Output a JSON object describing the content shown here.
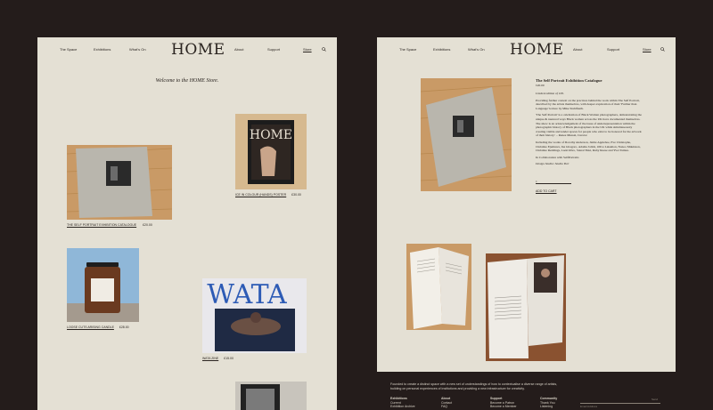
{
  "nav_left": {
    "items": [
      "The Space",
      "Exhibitions",
      "What's On"
    ],
    "logo": "HOME",
    "items_right": [
      "About",
      "Support",
      "Store"
    ],
    "search_icon": "search-icon"
  },
  "nav_right": {
    "items": [
      "The Space",
      "Exhibitions",
      "What's On"
    ],
    "logo": "HOME",
    "items_right": [
      "About",
      "Support",
      "Store"
    ],
    "search_icon": "search-icon"
  },
  "store": {
    "welcome": "Welcome to the HOME Store.",
    "products": [
      {
        "name": "The Self Portrait Exhibition Catalogue",
        "price": "£20.00"
      },
      {
        "name": "Ice in Colour (Hands) Poster",
        "price": "£30.00"
      },
      {
        "name": "Loose Cuts Arising Candle",
        "price": "£28.00"
      },
      {
        "name": "WATA Zine",
        "price": "£15.00"
      }
    ]
  },
  "detail": {
    "title": "The Self Portrait Exhibition Catalogue",
    "price": "£20.00",
    "edition": "Limited edition of 100.",
    "p1": "Providing further context on the practices behind the work within The Self Portrait, described by the artists themselves, with deeper exploration of their 'Further than Language' lecture by Mike Stuhlfauth.",
    "p2": "'The Self Portrait' is a celebration of Black Women photographers, demonstrating the unique & nuanced ways Black women across the UK have documented themselves. The show is an acknowledgement of the issue of underrepresentation within the photographic history of Black photographers in the UK while simultaneously creating visible and tender spaces for people who exist to be honored for the artwork of their history.' – Renee Mussai, Curator",
    "p3": "Including the works of Dorothy Anderson, Jamie Applebee, Eve Christophe, Christine Ejemuwa, Ina Gbagoro, Adama Jalloh, Oliva Lakamon, Nanoo Makinson, Christine Reddings, Lazzi Rivo, Stanal Yuki, Ruby Reese and Yvet Tamsu.",
    "p4": "In Collaboration with SelfPortraits",
    "p5": "Design Studio: Studio Yuri",
    "add_to_cart": "Add to cart"
  },
  "footer": {
    "tagline": "Founded to create a distinct space with a new set of understandings of how to contextualise a diverse range of artists, building on personal experiences of institutions and providing a new infrastructure for creativity.",
    "columns": [
      {
        "heading": "Exhibitions",
        "items": [
          "Current",
          "Exhibition Archive"
        ]
      },
      {
        "heading": "About",
        "items": [
          "Contact",
          "FAQ"
        ]
      },
      {
        "heading": "Support",
        "items": [
          "Become a Patron",
          "Become a Member"
        ]
      },
      {
        "heading": "Community",
        "items": [
          "Thank You",
          "Listening"
        ]
      }
    ],
    "email_label": "Email Address",
    "email_button": "Send"
  },
  "colors": {
    "background": "#241c1b",
    "panel": "#e4e0d4",
    "text": "#2a2420"
  }
}
